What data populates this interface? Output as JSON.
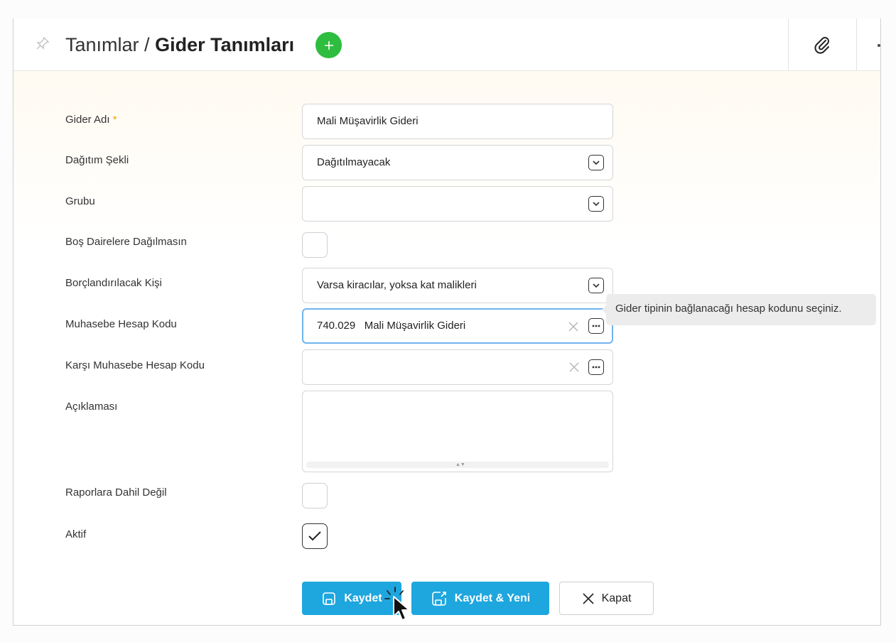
{
  "header": {
    "breadcrumb_parent": "Tanımlar",
    "breadcrumb_separator": "/",
    "page_title": "Gider Tanımları",
    "add_icon": "plus-icon",
    "pin_icon": "pin-icon",
    "attach_icon": "paperclip-icon"
  },
  "form": {
    "gider_adi": {
      "label": "Gider Adı",
      "required_mark": "*",
      "value": "Mali Müşavirlik Gideri"
    },
    "dagitim_sekli": {
      "label": "Dağıtım Şekli",
      "value": "Dağıtılmayacak"
    },
    "grubu": {
      "label": "Grubu",
      "value": ""
    },
    "bos_daireler": {
      "label": "Boş Dairelere Dağılmasın",
      "checked": false
    },
    "borclandirilacak": {
      "label": "Borçlandırılacak Kişi",
      "value": "Varsa kiracılar, yoksa kat malikleri"
    },
    "muhasebe_kodu": {
      "label": "Muhasebe Hesap Kodu",
      "value": "740.029   Mali Müşavirlik Gideri"
    },
    "karsi_kodu": {
      "label": "Karşı Muhasebe Hesap Kodu",
      "value": ""
    },
    "aciklama": {
      "label": "Açıklaması",
      "value": ""
    },
    "raporlara": {
      "label": "Raporlara Dahil Değil",
      "checked": false
    },
    "aktif": {
      "label": "Aktif",
      "checked": true
    }
  },
  "tooltip": {
    "text": "Gider tipinin bağlanacağı hesap kodunu seçiniz."
  },
  "buttons": {
    "save": "Kaydet",
    "save_new": "Kaydet & Yeni",
    "close": "Kapat"
  },
  "colors": {
    "primary": "#1ea6de",
    "add_green": "#2ebd3f",
    "required": "#f5a300",
    "focus_border": "#6fb4ef"
  }
}
